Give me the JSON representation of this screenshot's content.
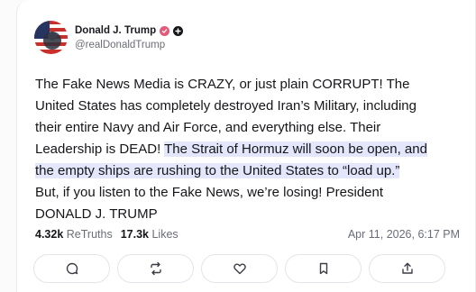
{
  "author": {
    "name": "Donald J. Trump",
    "handle": "@realDonaldTrump",
    "avatar_icon": "flag-avatar",
    "badges": [
      "verified-icon",
      "plus-icon"
    ]
  },
  "post": {
    "text_before": "The Fake News Media is CRAZY, or just plain CORRUPT! The\nUnited States has completely destroyed Iran’s Military, including\ntheir entire Navy and Air Force, and everything else. Their\nLeadership is DEAD! ",
    "text_highlight": "The Strait of Hormuz will soon be open, and\nthe empty ships are rushing to the United States to “load up.”",
    "text_after": "\nBut, if you listen to the Fake News, we’re losing! President\nDONALD J. TRUMP"
  },
  "stats": {
    "retruths_count": "4.32k",
    "retruths_label": "ReTruths",
    "likes_count": "17.3k",
    "likes_label": "Likes"
  },
  "timestamp": "Apr 11, 2026, 6:17 PM",
  "actions": [
    "reply-icon",
    "retruth-icon",
    "like-icon",
    "bookmark-icon",
    "share-icon"
  ],
  "colors": {
    "highlight": "#e4e7fb",
    "verified": "#e35b79",
    "muted": "#6b6d78"
  }
}
